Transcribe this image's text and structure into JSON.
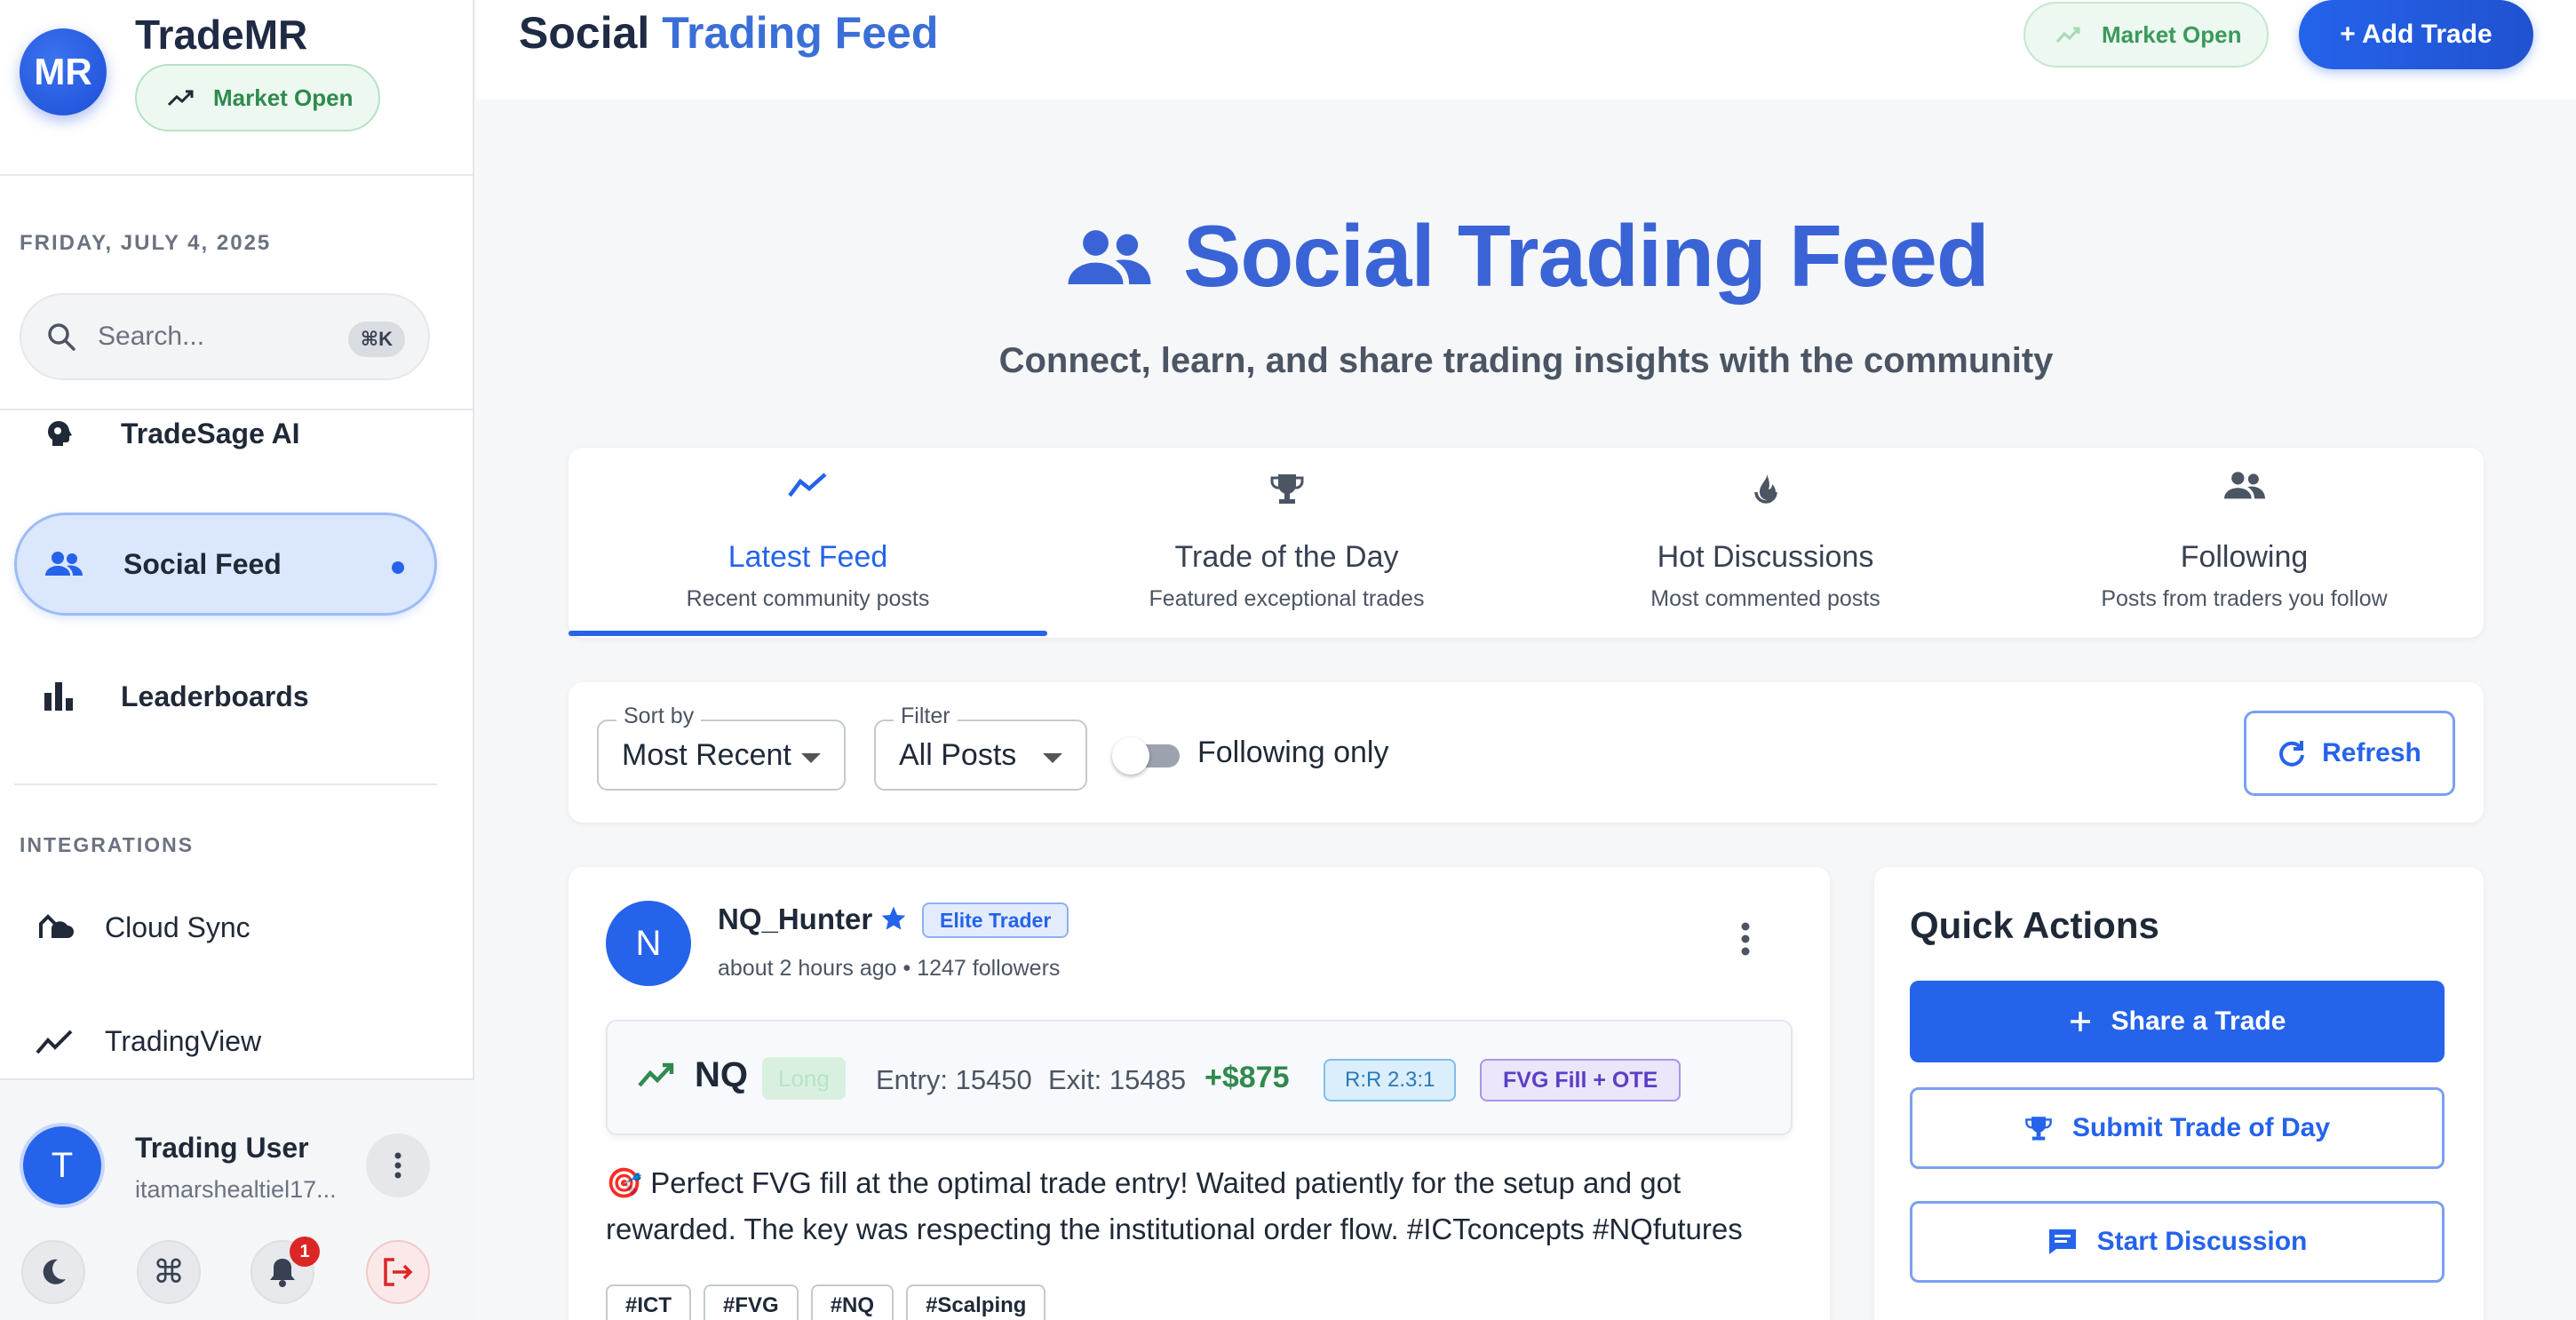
{
  "sidebar": {
    "logo_initials": "MR",
    "app_name": "TradeMR",
    "market_status": "Market Open",
    "date": "FRIDAY, JULY 4, 2025",
    "search": {
      "placeholder": "Search...",
      "shortcut": "⌘K"
    },
    "nav_items": [
      {
        "label": "TradeSage AI",
        "icon": "brain-icon",
        "active": false
      },
      {
        "label": "Social Feed",
        "icon": "people-icon",
        "active": true
      },
      {
        "label": "Leaderboards",
        "icon": "bar-chart-icon",
        "active": false
      }
    ],
    "integrations_label": "INTEGRATIONS",
    "integrations": [
      {
        "label": "Cloud Sync",
        "icon": "cloud-sync-icon"
      },
      {
        "label": "TradingView",
        "icon": "trending-line-icon"
      }
    ],
    "user": {
      "initial": "T",
      "name": "Trading User",
      "email": "itamarshealtiel17..."
    },
    "notification_count": "1"
  },
  "header": {
    "title_part1": "Social",
    "title_part2": "Trading Feed",
    "market_status": "Market Open",
    "add_trade_label": "+ Add Trade"
  },
  "hero": {
    "title": "Social Trading Feed",
    "subtitle": "Connect, learn, and share trading insights with the community"
  },
  "tabs": [
    {
      "label": "Latest Feed",
      "desc": "Recent community posts",
      "icon": "trending-icon",
      "active": true
    },
    {
      "label": "Trade of the Day",
      "desc": "Featured exceptional trades",
      "icon": "trophy-icon",
      "active": false
    },
    {
      "label": "Hot Discussions",
      "desc": "Most commented posts",
      "icon": "fire-icon",
      "active": false
    },
    {
      "label": "Following",
      "desc": "Posts from traders you follow",
      "icon": "people-icon",
      "active": false
    }
  ],
  "filters": {
    "sort_label": "Sort by",
    "sort_value": "Most Recent",
    "filter_label": "Filter",
    "filter_value": "All Posts",
    "following_only_label": "Following only",
    "following_only": false,
    "refresh_label": "Refresh"
  },
  "post": {
    "avatar_initial": "N",
    "author": "NQ_Hunter",
    "badge": "Elite Trader",
    "meta": "about 2 hours ago • 1247 followers",
    "trade": {
      "symbol": "NQ",
      "direction": "Long",
      "entry": "Entry: 15450",
      "exit": "Exit: 15485",
      "pnl": "+$875",
      "rr": "R:R 2.3:1",
      "setup": "FVG Fill + OTE"
    },
    "body": "🎯 Perfect FVG fill at the optimal trade entry! Waited patiently for the setup and got rewarded. The key was respecting the institutional order flow. #ICTconcepts #NQfutures",
    "hashtags": [
      "#ICT",
      "#FVG",
      "#NQ",
      "#Scalping"
    ]
  },
  "quick_actions": {
    "title": "Quick Actions",
    "share_label": "Share a Trade",
    "submit_label": "Submit Trade of Day",
    "discussion_label": "Start Discussion"
  },
  "colors": {
    "accent": "#2563eb",
    "success": "#2f8a4e",
    "danger": "#dc2626"
  }
}
